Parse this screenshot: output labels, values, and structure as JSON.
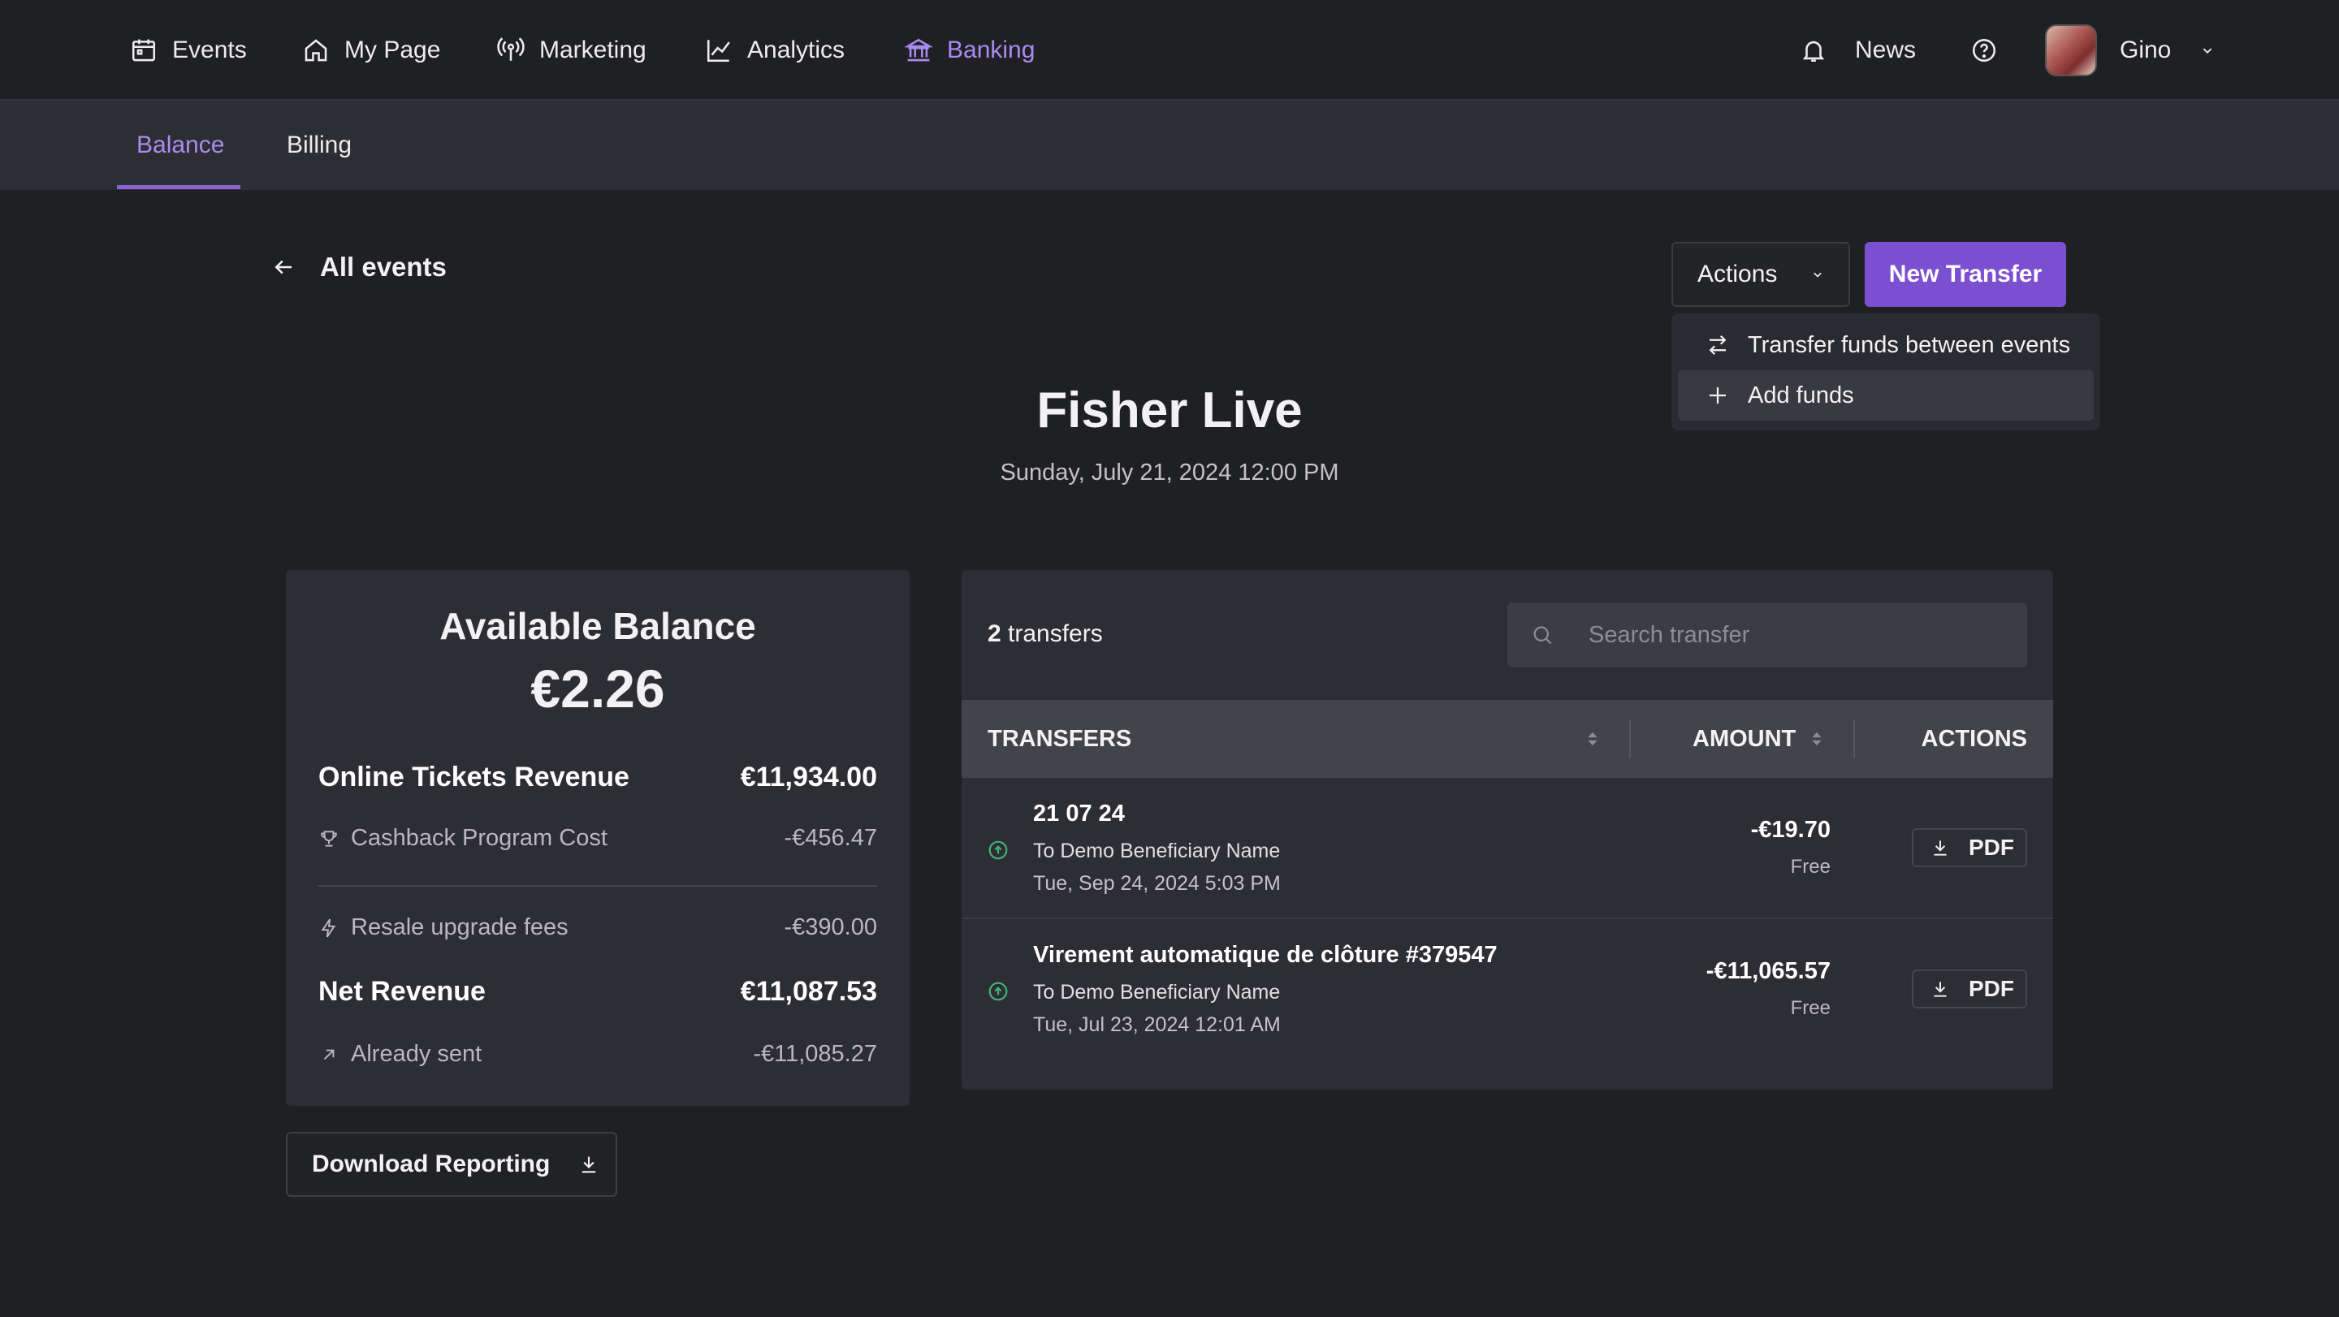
{
  "nav": {
    "items": [
      {
        "label": "Events",
        "icon": "calendar-icon"
      },
      {
        "label": "My Page",
        "icon": "home-icon"
      },
      {
        "label": "Marketing",
        "icon": "broadcast-icon"
      },
      {
        "label": "Analytics",
        "icon": "chart-line-icon"
      },
      {
        "label": "Banking",
        "icon": "bank-icon",
        "active": true
      }
    ],
    "news_label": "News",
    "user_name": "Gino",
    "accent_color": "#a98cf0"
  },
  "subnav": {
    "tabs": [
      {
        "label": "Balance",
        "active": true
      },
      {
        "label": "Billing"
      }
    ]
  },
  "header": {
    "back_label": "All events",
    "actions_label": "Actions",
    "new_transfer_label": "New Transfer",
    "dropdown": [
      {
        "label": "Transfer funds between events",
        "icon": "transfer-arrows-icon"
      },
      {
        "label": "Add funds",
        "icon": "plus-icon",
        "highlighted": true
      }
    ]
  },
  "event": {
    "title": "Fisher Live",
    "date": "Sunday, July 21, 2024 12:00 PM"
  },
  "balance": {
    "title": "Available Balance",
    "amount": "€2.26",
    "online_tickets_label": "Online Tickets Revenue",
    "online_tickets_value": "€11,934.00",
    "cashback_label": "Cashback Program Cost",
    "cashback_value": "-€456.47",
    "resale_label": "Resale upgrade fees",
    "resale_value": "-€390.00",
    "net_label": "Net Revenue",
    "net_value": "€11,087.53",
    "sent_label": "Already sent",
    "sent_value": "-€11,085.27",
    "download_label": "Download Reporting"
  },
  "transfers": {
    "count": "2",
    "count_suffix": "transfers",
    "search_placeholder": "Search transfer",
    "col_transfers": "TRANSFERS",
    "col_amount": "AMOUNT",
    "col_actions": "ACTIONS",
    "pdf_label": "PDF",
    "status_color": "#3fb57a",
    "rows": [
      {
        "name": "21 07 24",
        "beneficiary": "To Demo Beneficiary Name",
        "date": "Tue, Sep 24, 2024 5:03 PM",
        "amount": "-€19.70",
        "fee": "Free"
      },
      {
        "name": "Virement automatique de clôture #379547",
        "beneficiary": "To Demo Beneficiary Name",
        "date": "Tue, Jul 23, 2024 12:01 AM",
        "amount": "-€11,065.57",
        "fee": "Free"
      }
    ]
  }
}
